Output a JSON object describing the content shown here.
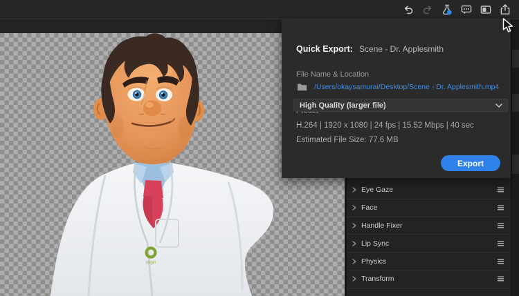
{
  "toolbar": {
    "icons": [
      {
        "name": "undo-icon",
        "enabled": true
      },
      {
        "name": "redo-icon",
        "enabled": false
      },
      {
        "name": "test-flask-icon",
        "badge_color": "#2f8df0"
      },
      {
        "name": "comments-icon"
      },
      {
        "name": "panel-layout-icon"
      },
      {
        "name": "share-export-icon"
      }
    ]
  },
  "quick_export": {
    "title_label": "Quick Export:",
    "scene_name": "Scene - Dr. Applesmith",
    "file_section_label": "File Name & Location",
    "file_path": "/Users/okaysamurai/Desktop/Scene - Dr. Applesmith.mp4",
    "preset_label": "Preset",
    "preset_value": "High Quality (larger file)",
    "specs_line": "H.264 | 1920 x 1080 | 24 fps | 15.52 Mbps | 40 sec",
    "estimated_file_size": "Estimated File Size: 77.6 MB",
    "export_button_label": "Export",
    "link_color": "#3d8de8",
    "button_color": "#2e82e9"
  },
  "properties_panel": {
    "rows": [
      {
        "label": "Eye Gaze"
      },
      {
        "label": "Face"
      },
      {
        "label": "Handle Fixer"
      },
      {
        "label": "Lip Sync"
      },
      {
        "label": "Physics"
      },
      {
        "label": "Transform"
      }
    ]
  },
  "viewport": {
    "badge_text": "origin",
    "checker_light": "#aeaeae",
    "checker_dark": "#8e8e8e"
  }
}
